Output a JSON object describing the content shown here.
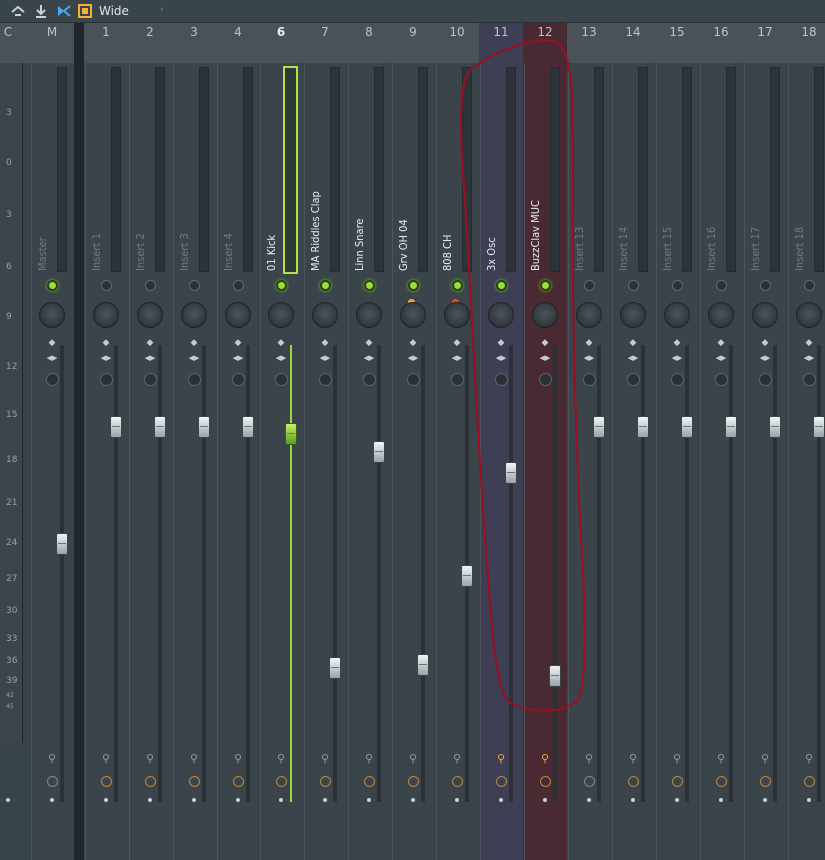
{
  "toolbar": {
    "view_label": "Wide",
    "icons": [
      "snap-icon",
      "pin-icon",
      "routing-icon",
      "layout-icon"
    ],
    "arrow": "›"
  },
  "header": {
    "prefix_labels": [
      "C",
      "M"
    ],
    "selected": "6"
  },
  "scale": [
    "3",
    "0",
    "3",
    "6",
    "9",
    "12",
    "15",
    "18",
    "21",
    "24",
    "27",
    "30",
    "33",
    "36",
    "39",
    "42",
    "45"
  ],
  "strips": [
    {
      "num": "M",
      "name": "Master",
      "named": false,
      "led_on": true,
      "fader_level": 0.47
    },
    {
      "num": "1",
      "name": "Insert 1",
      "named": false,
      "led_on": false,
      "fader_level": 0.8
    },
    {
      "num": "2",
      "name": "Insert 2",
      "named": false,
      "led_on": false,
      "fader_level": 0.8
    },
    {
      "num": "3",
      "name": "Insert 3",
      "named": false,
      "led_on": false,
      "fader_level": 0.8
    },
    {
      "num": "4",
      "name": "Insert 4",
      "named": false,
      "led_on": false,
      "fader_level": 0.8
    },
    {
      "num": "6",
      "name": "01 Kick",
      "named": true,
      "led_on": true,
      "fader_level": 0.78,
      "selected": true
    },
    {
      "num": "7",
      "name": "MA Riddles Clap",
      "named": true,
      "led_on": true,
      "fader_level": 0.12
    },
    {
      "num": "8",
      "name": "Linn Snare",
      "named": true,
      "led_on": true,
      "fader_level": 0.73
    },
    {
      "num": "9",
      "name": "Grv OH 04",
      "named": true,
      "led_on": true,
      "fader_level": 0.13,
      "knob_mark": "orange"
    },
    {
      "num": "10",
      "name": "808 CH",
      "named": true,
      "led_on": true,
      "fader_level": 0.38,
      "knob_mark": "red"
    },
    {
      "num": "11",
      "name": "3x Osc",
      "named": true,
      "led_on": true,
      "fader_level": 0.67,
      "highlight": "purple"
    },
    {
      "num": "12",
      "name": "BuzzClav MUC",
      "named": true,
      "led_on": true,
      "fader_level": 0.1,
      "highlight": "red"
    },
    {
      "num": "13",
      "name": "Insert 13",
      "named": false,
      "led_on": false,
      "fader_level": 0.8
    },
    {
      "num": "14",
      "name": "Insert 14",
      "named": false,
      "led_on": false,
      "fader_level": 0.8
    },
    {
      "num": "15",
      "name": "Insert 15",
      "named": false,
      "led_on": false,
      "fader_level": 0.8
    },
    {
      "num": "16",
      "name": "Insert 16",
      "named": false,
      "led_on": false,
      "fader_level": 0.8
    },
    {
      "num": "17",
      "name": "Insert 17",
      "named": false,
      "led_on": false,
      "fader_level": 0.8
    },
    {
      "num": "18",
      "name": "Insert 18",
      "named": false,
      "led_on": false,
      "fader_level": 0.8
    }
  ],
  "colors": {
    "led_on": "#97e036",
    "selected_outline": "#b6e04a",
    "highlight_purple": "#3e3f55",
    "highlight_red": "#4a2a32",
    "scribble": "#9b0f1e"
  }
}
